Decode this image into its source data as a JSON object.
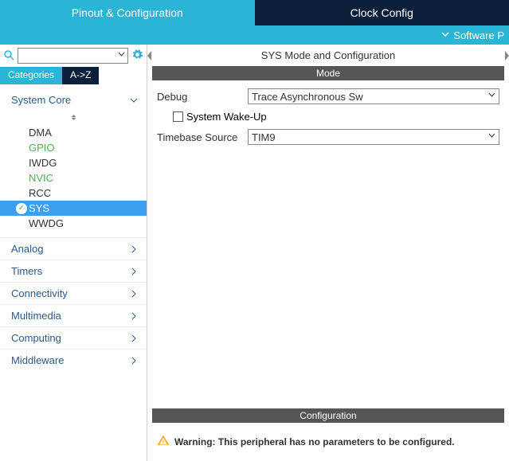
{
  "tabs": {
    "pinout": "Pinout & Configuration",
    "clock": "Clock Config"
  },
  "subbar": {
    "software": "Software P"
  },
  "sidebar": {
    "viewTabs": {
      "categories": "Categories",
      "az": "A->Z"
    },
    "categories": [
      {
        "label": "System Core",
        "expanded": true
      },
      {
        "label": "Analog",
        "expanded": false
      },
      {
        "label": "Timers",
        "expanded": false
      },
      {
        "label": "Connectivity",
        "expanded": false
      },
      {
        "label": "Multimedia",
        "expanded": false
      },
      {
        "label": "Computing",
        "expanded": false
      },
      {
        "label": "Middleware",
        "expanded": false
      }
    ],
    "systemCoreItems": [
      {
        "label": "DMA",
        "class": ""
      },
      {
        "label": "GPIO",
        "class": "green"
      },
      {
        "label": "IWDG",
        "class": ""
      },
      {
        "label": "NVIC",
        "class": "green"
      },
      {
        "label": "RCC",
        "class": ""
      },
      {
        "label": "SYS",
        "class": "selected"
      },
      {
        "label": "WWDG",
        "class": ""
      }
    ]
  },
  "content": {
    "title": "SYS Mode and Configuration",
    "modeHeader": "Mode",
    "configHeader": "Configuration",
    "debugLabel": "Debug",
    "debugValue": "Trace Asynchronous Sw",
    "wakeupLabel": "System Wake-Up",
    "timebaseLabel": "Timebase Source",
    "timebaseValue": "TIM9",
    "warning": "Warning: This peripheral has no parameters to be configured."
  }
}
